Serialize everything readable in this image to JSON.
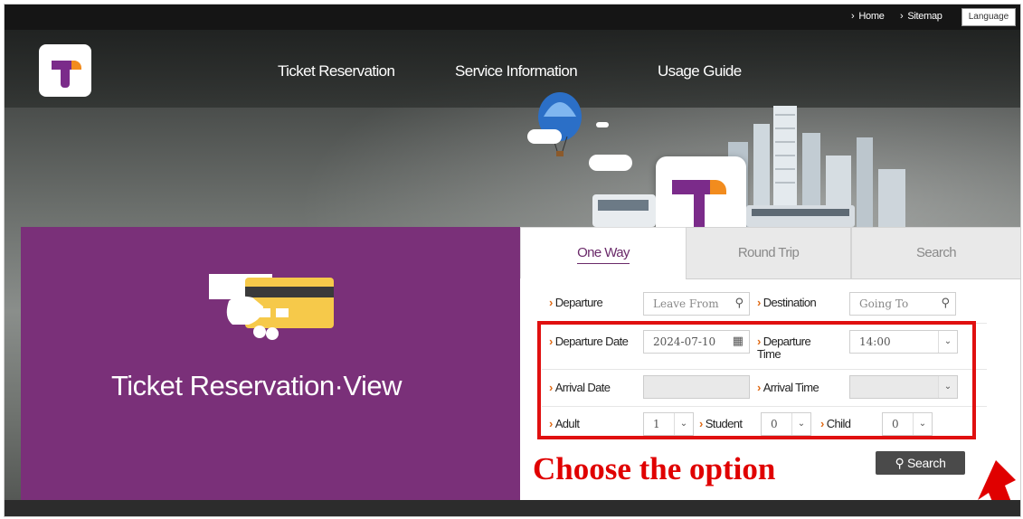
{
  "util_bar": {
    "home": "Home",
    "sitemap": "Sitemap",
    "language": "Language"
  },
  "nav": {
    "items": [
      "Ticket Reservation",
      "Service Information",
      "Usage Guide"
    ]
  },
  "hero": {
    "title": "Ticket Reservation·View"
  },
  "tabs": [
    {
      "label": "One Way",
      "active": true
    },
    {
      "label": "Round Trip",
      "active": false
    },
    {
      "label": "Search",
      "active": false
    }
  ],
  "form": {
    "departure_label": "Departure",
    "departure_placeholder": "Leave From",
    "destination_label": "Destination",
    "destination_placeholder": "Going To",
    "departure_date_label": "Departure Date",
    "departure_date_value": "2024-07-10",
    "departure_time_label": "Departure Time",
    "departure_time_value": "14:00",
    "arrival_date_label": "Arrival Date",
    "arrival_time_label": "Arrival Time",
    "adult_label": "Adult",
    "adult_value": "1",
    "student_label": "Student",
    "student_value": "0",
    "child_label": "Child",
    "child_value": "0",
    "search_button": "Search"
  },
  "annotation": {
    "callout_text": "Choose the option",
    "color": "#e00000"
  },
  "colors": {
    "brand_purple": "#7a3079",
    "accent_orange": "#e06a15",
    "header_dark": "#151515"
  }
}
